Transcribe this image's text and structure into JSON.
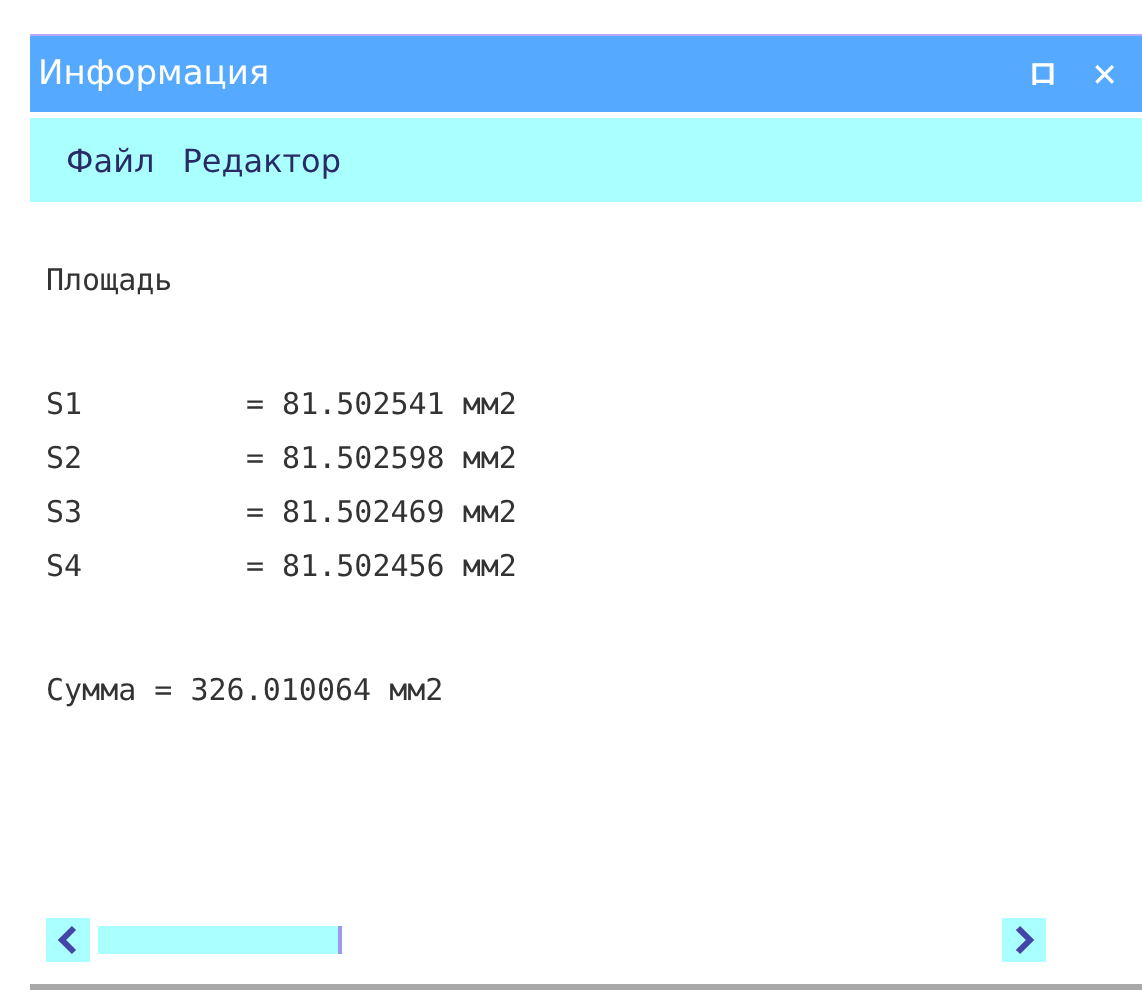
{
  "window": {
    "title": "Информация",
    "buttons": [
      "ロ",
      "✕"
    ]
  },
  "menu": [
    {
      "label": "Файл"
    },
    {
      "label": "Редактор"
    }
  ],
  "content": {
    "heading": "Площадь",
    "rows": [
      {
        "name": "S1",
        "value": "= 81.502541 мм2"
      },
      {
        "name": "S2",
        "value": "= 81.502598 мм2"
      },
      {
        "name": "S3",
        "value": "= 81.502469 мм2"
      },
      {
        "name": "S4",
        "value": "= 81.502456 мм2"
      }
    ],
    "total": "Сумма = 326.010064 мм2"
  }
}
